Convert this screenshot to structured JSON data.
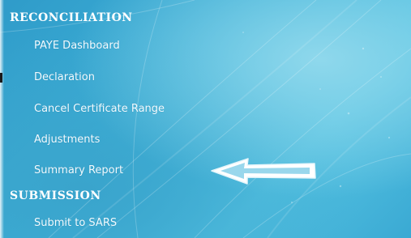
{
  "menu": {
    "sections": [
      {
        "title": "RECONCILIATION",
        "items": [
          {
            "label": "PAYE Dashboard"
          },
          {
            "label": "Declaration"
          },
          {
            "label": "Cancel Certificate Range"
          },
          {
            "label": "Adjustments"
          },
          {
            "label": "Summary Report"
          }
        ]
      },
      {
        "title": "SUBMISSION",
        "items": [
          {
            "label": "Submit to SARS"
          }
        ]
      }
    ]
  },
  "colors": {
    "background": "#3fb2d8",
    "text": "#ffffff",
    "arrow_fill": "#ffffff"
  },
  "annotation": {
    "icon": "left-arrow-icon",
    "points_to": "Summary Report"
  }
}
